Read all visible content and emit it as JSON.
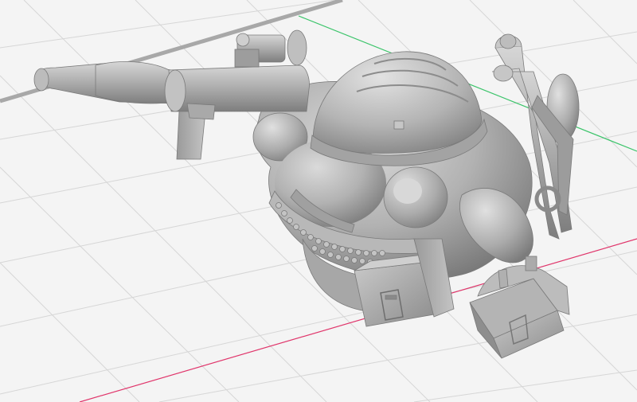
{
  "viewport": {
    "background": "#f4f4f4",
    "grid_color": "#d4d4d4",
    "axis_x_color": "#e0356b",
    "axis_y_color": "#3bc46a",
    "model_color": "#a9a9a9",
    "model_highlight": "#d8d8d8",
    "model_shadow": "#6f6f6f"
  }
}
